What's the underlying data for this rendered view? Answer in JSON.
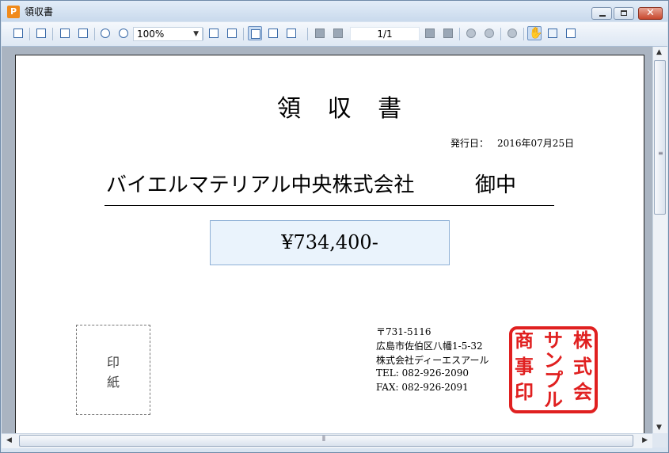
{
  "window": {
    "title": "領収書"
  },
  "icons": {
    "app": "app-icon",
    "minimize": "minimize-icon",
    "maximize": "maximize-icon",
    "close": "close-icon",
    "toolbar": [
      "copy-icon",
      "print-icon",
      "copy-page-icon",
      "find-icon",
      "zoom-in-icon",
      "zoom-out-icon",
      "fit-width-icon",
      "fit-page-icon",
      "single-page-icon",
      "continuous-page-icon",
      "multi-page-icon",
      "first-page-icon",
      "previous-page-icon",
      "next-page-icon",
      "last-page-icon",
      "back-icon",
      "forward-icon",
      "refresh-icon",
      "hand-tool-icon",
      "select-text-icon",
      "snapshot-icon"
    ]
  },
  "toolbar": {
    "zoom_value": "100%",
    "page_indicator": "1/1"
  },
  "document": {
    "title": "領 収 書",
    "issue_label": "発行日：",
    "issue_date": "2016年07月25日",
    "recipient": "バイエルマテリアル中央株式会社",
    "recipient_suffix": "御中",
    "amount": "¥734,400-",
    "revenue_stamp_label": "印\n紙",
    "sender": {
      "postal": "〒731-5116",
      "address": "広島市佐伯区八幡1-5-32",
      "company": "株式会社ディーエスアール",
      "tel": "TEL: 082-926-2090",
      "fax": "FAX: 082-926-2091"
    },
    "seal_text": "株式会社サンプル商事印",
    "seal_color": "#e02020"
  },
  "scrollbar": {
    "grip": "≡",
    "hgrip": "⦀"
  }
}
